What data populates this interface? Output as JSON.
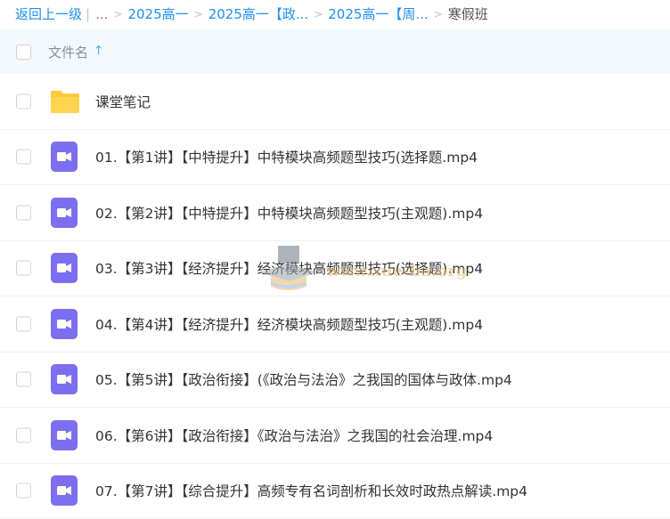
{
  "breadcrumb": {
    "back": "返回上一级",
    "ellipsis": "...",
    "crumbs": [
      "2025高一",
      "2025高一【政...",
      "2025高一【周..."
    ],
    "current": "寒假班"
  },
  "header": {
    "column_label": "文件名",
    "sort_icon": "arrow-up-icon"
  },
  "files": [
    {
      "type": "folder",
      "icon": "folder-icon",
      "name": "课堂笔记"
    },
    {
      "type": "video",
      "icon": "video-icon",
      "name": "01.【第1讲】【中特提升】中特模块高频题型技巧(选择题.mp4"
    },
    {
      "type": "video",
      "icon": "video-icon",
      "name": "02.【第2讲】【中特提升】中特模块高频题型技巧(主观题).mp4"
    },
    {
      "type": "video",
      "icon": "video-icon",
      "name": "03.【第3讲】【经济提升】经济模块高频题型技巧(选择题).mp4"
    },
    {
      "type": "video",
      "icon": "video-icon",
      "name": "04.【第4讲】【经济提升】经济模块高频题型技巧(主观题).mp4"
    },
    {
      "type": "video",
      "icon": "video-icon",
      "name": "05.【第5讲】【政治衔接】(《政治与法治》之我国的国体与政体.mp4"
    },
    {
      "type": "video",
      "icon": "video-icon",
      "name": "06.【第6讲】【政治衔接】《政治与法治》之我国的社会治理.mp4"
    },
    {
      "type": "video",
      "icon": "video-icon",
      "name": "07.【第7讲】【综合提升】高频专有名词剖析和长效时政热点解读.mp4"
    }
  ],
  "watermark": {
    "text": "www.xue-ba.org",
    "icon": "graduation-cap-icon"
  },
  "colors": {
    "link": "#1f8ef1",
    "header_bg": "#f4f9fe",
    "folder": "#ffd54f",
    "video": "#7d6ef0"
  }
}
